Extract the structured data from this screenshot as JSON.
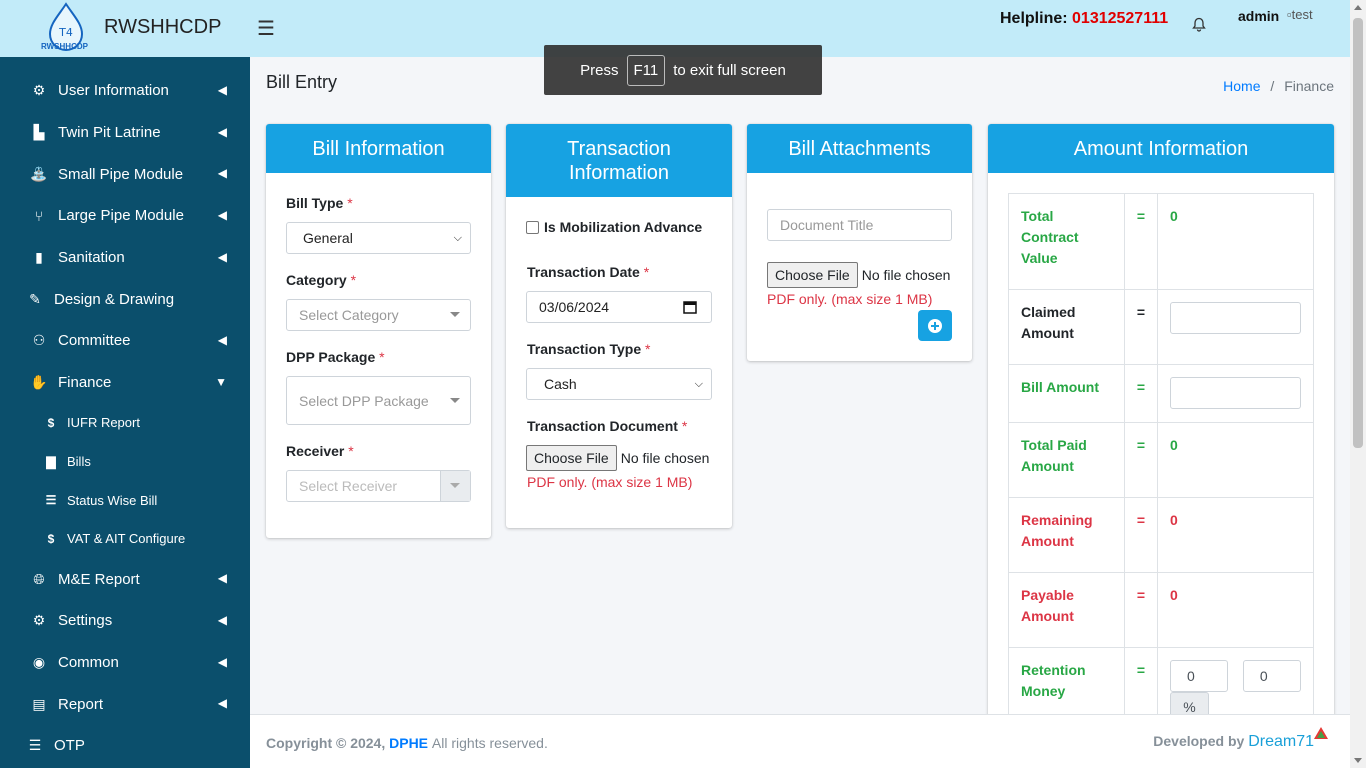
{
  "header": {
    "logo_text": "RWSHHCDP",
    "logo_glyph": "T4",
    "brand": "RWSHHCDP",
    "helpline_label": "Helpline:",
    "helpline_number": "01312527111",
    "user": "admin",
    "avatar_alt": "test"
  },
  "sidebar": {
    "items": [
      {
        "label": "User Information",
        "icon": "users-cog-icon"
      },
      {
        "label": "Twin Pit Latrine",
        "icon": "toilet-icon"
      },
      {
        "label": "Small Pipe Module",
        "icon": "faucet-icon"
      },
      {
        "label": "Large Pipe Module",
        "icon": "pipe-branch-icon"
      },
      {
        "label": "Sanitation",
        "icon": "sanitation-icon"
      },
      {
        "label": "Design & Drawing",
        "icon": "pen-icon"
      },
      {
        "label": "Committee",
        "icon": "people-icon"
      },
      {
        "label": "Finance",
        "icon": "hand-money-icon"
      }
    ],
    "finance_sub": [
      {
        "label": "IUFR Report",
        "icon": "$"
      },
      {
        "label": "Bills",
        "icon": "file-icon"
      },
      {
        "label": "Status Wise Bill",
        "icon": "list-icon"
      },
      {
        "label": "VAT & AIT Configure",
        "icon": "$"
      }
    ],
    "items_after": [
      {
        "label": "M&E Report",
        "icon": "globe-icon"
      },
      {
        "label": "Settings",
        "icon": "gear-icon"
      },
      {
        "label": "Common",
        "icon": "circle-down-icon"
      },
      {
        "label": "Report",
        "icon": "report-icon"
      },
      {
        "label": "OTP",
        "icon": "list-icon"
      }
    ]
  },
  "page": {
    "title": "Bill Entry",
    "breadcrumb_home": "Home",
    "breadcrumb_sep": "/",
    "breadcrumb_current": "Finance"
  },
  "fullscreen_toast": {
    "press": "Press",
    "key": "F11",
    "rest": "to exit full screen"
  },
  "bill_info": {
    "title": "Bill Information",
    "bill_type_label": "Bill Type",
    "bill_type_value": "General",
    "category_label": "Category",
    "category_placeholder": "Select Category",
    "dpp_label": "DPP Package",
    "dpp_placeholder": "Select DPP Package",
    "receiver_label": "Receiver",
    "receiver_placeholder": "Select Receiver",
    "required_mark": "*"
  },
  "transaction_info": {
    "title": "Transaction Information",
    "mobilization_label": "Is Mobilization Advance",
    "date_label": "Transaction Date",
    "date_value": "03/06/2024",
    "type_label": "Transaction Type",
    "type_value": "Cash",
    "document_label": "Transaction Document",
    "choose_file": "Choose File",
    "no_file": "No file chosen",
    "pdf_note": "PDF only. (max size 1 MB)"
  },
  "attachments": {
    "title": "Bill Attachments",
    "doc_title_placeholder": "Document Title",
    "choose_file": "Choose File",
    "no_file": "No file chosen",
    "pdf_note": "PDF only. (max size 1 MB)"
  },
  "amount_info": {
    "title": "Amount Information",
    "eq": "=",
    "total_contract_label": "Total Contract Value",
    "total_contract_value": "0",
    "claimed_label": "Claimed Amount",
    "bill_amount_label": "Bill Amount",
    "total_paid_label": "Total Paid Amount",
    "total_paid_value": "0",
    "remaining_label": "Remaining Amount",
    "remaining_value": "0",
    "payable_label": "Payable Amount",
    "payable_value": "0",
    "retention_label": "Retention Money",
    "retention_percent": "0",
    "retention_amount": "0",
    "percent_sign": "%"
  },
  "footer": {
    "copyright": "Copyright © 2024,",
    "org": "DPHE",
    "rights": "All rights reserved.",
    "developed_by": "Developed by",
    "developer": "Dream71"
  },
  "colors": {
    "header_bg": "#c2ebf9",
    "sidebar_bg": "#0b4f6c",
    "card_header": "#17a2e2",
    "danger": "#dc3545",
    "success": "#28a745"
  }
}
